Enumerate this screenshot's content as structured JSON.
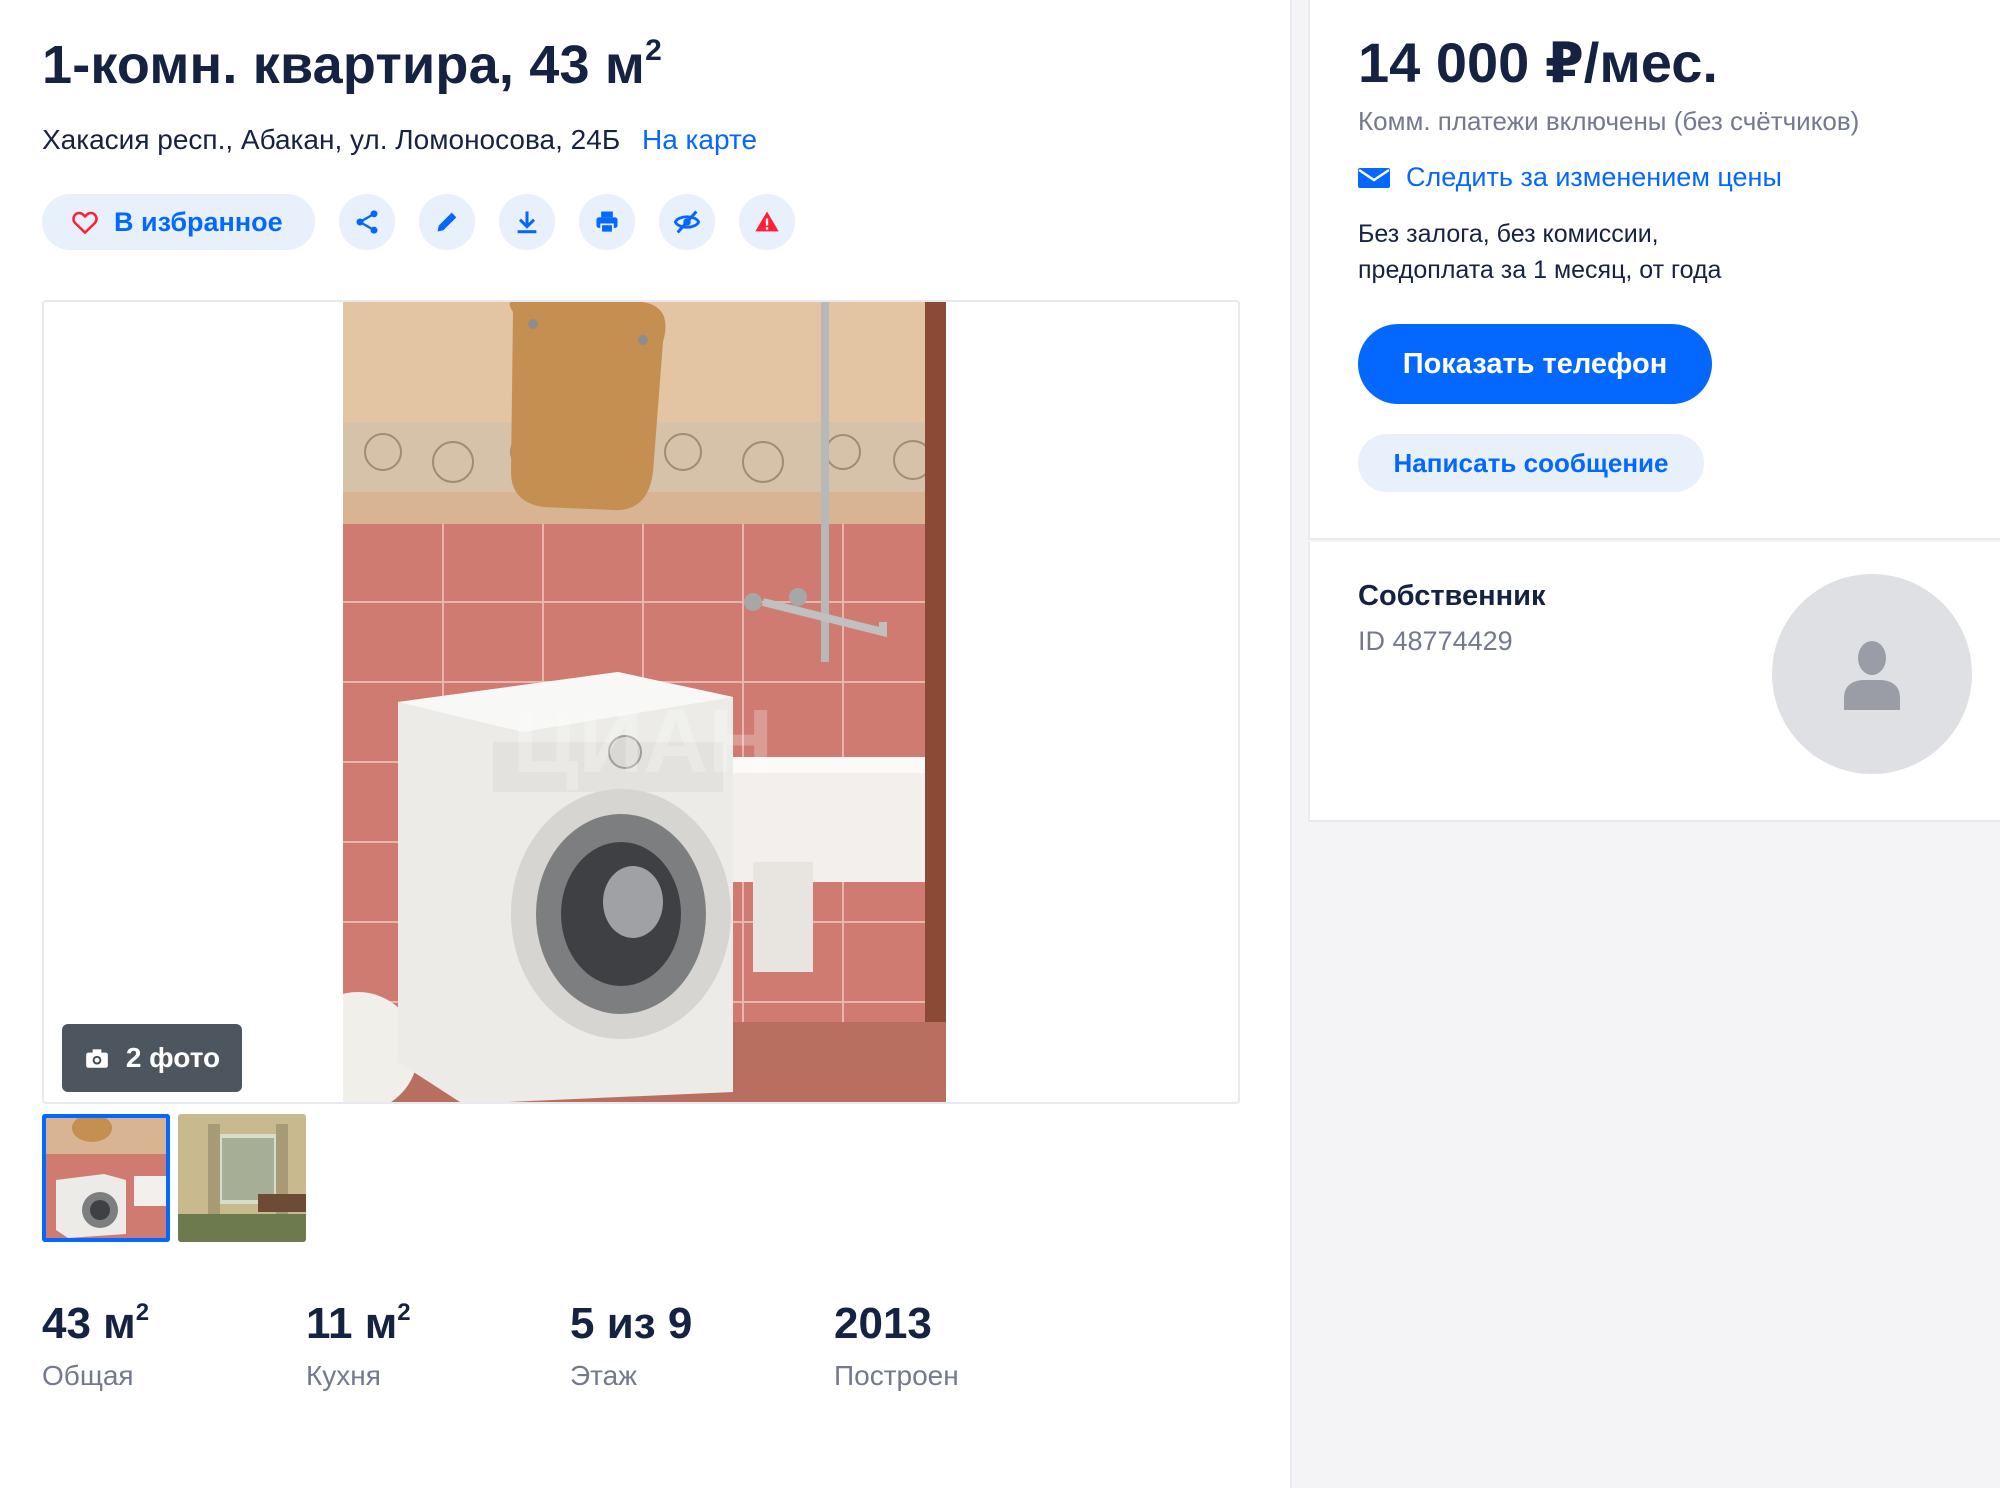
{
  "listing": {
    "title": "1-комн. квартира, 43 м",
    "title_sup": "2",
    "address": "Хакасия респ., Абакан, ул. Ломоносова, 24Б",
    "map_link": "На карте"
  },
  "actions": {
    "favorite_label": "В избранное",
    "icons": [
      "heart-icon",
      "share-icon",
      "pencil-icon",
      "download-icon",
      "print-icon",
      "hide-icon",
      "warning-icon"
    ]
  },
  "gallery": {
    "photo_count_label": "2 фото",
    "thumbnails": [
      "thumbnail-bathroom",
      "thumbnail-room"
    ]
  },
  "facts": [
    {
      "value": "43 м",
      "sup": "2",
      "label": "Общая"
    },
    {
      "value": "11 м",
      "sup": "2",
      "label": "Кухня"
    },
    {
      "value": "5 из 9",
      "sup": "",
      "label": "Этаж"
    },
    {
      "value": "2013",
      "sup": "",
      "label": "Построен"
    }
  ],
  "price": {
    "amount": "14 000 ₽/мес.",
    "utilities": "Комм. платежи включены (без счётчиков)",
    "follow_label": "Следить за изменением цены",
    "terms_line1": "Без залога, без комиссии,",
    "terms_line2": "предоплата за 1 месяц, от года",
    "show_phone": "Показать телефон",
    "write_message": "Написать сообщение"
  },
  "owner": {
    "title": "Собственник",
    "id": "ID 48774429"
  },
  "colors": {
    "accent": "#0468ff",
    "text": "#152242",
    "muted": "#737a8e",
    "light_accent_bg": "#e8f0fc",
    "danger": "#ff1f34"
  }
}
